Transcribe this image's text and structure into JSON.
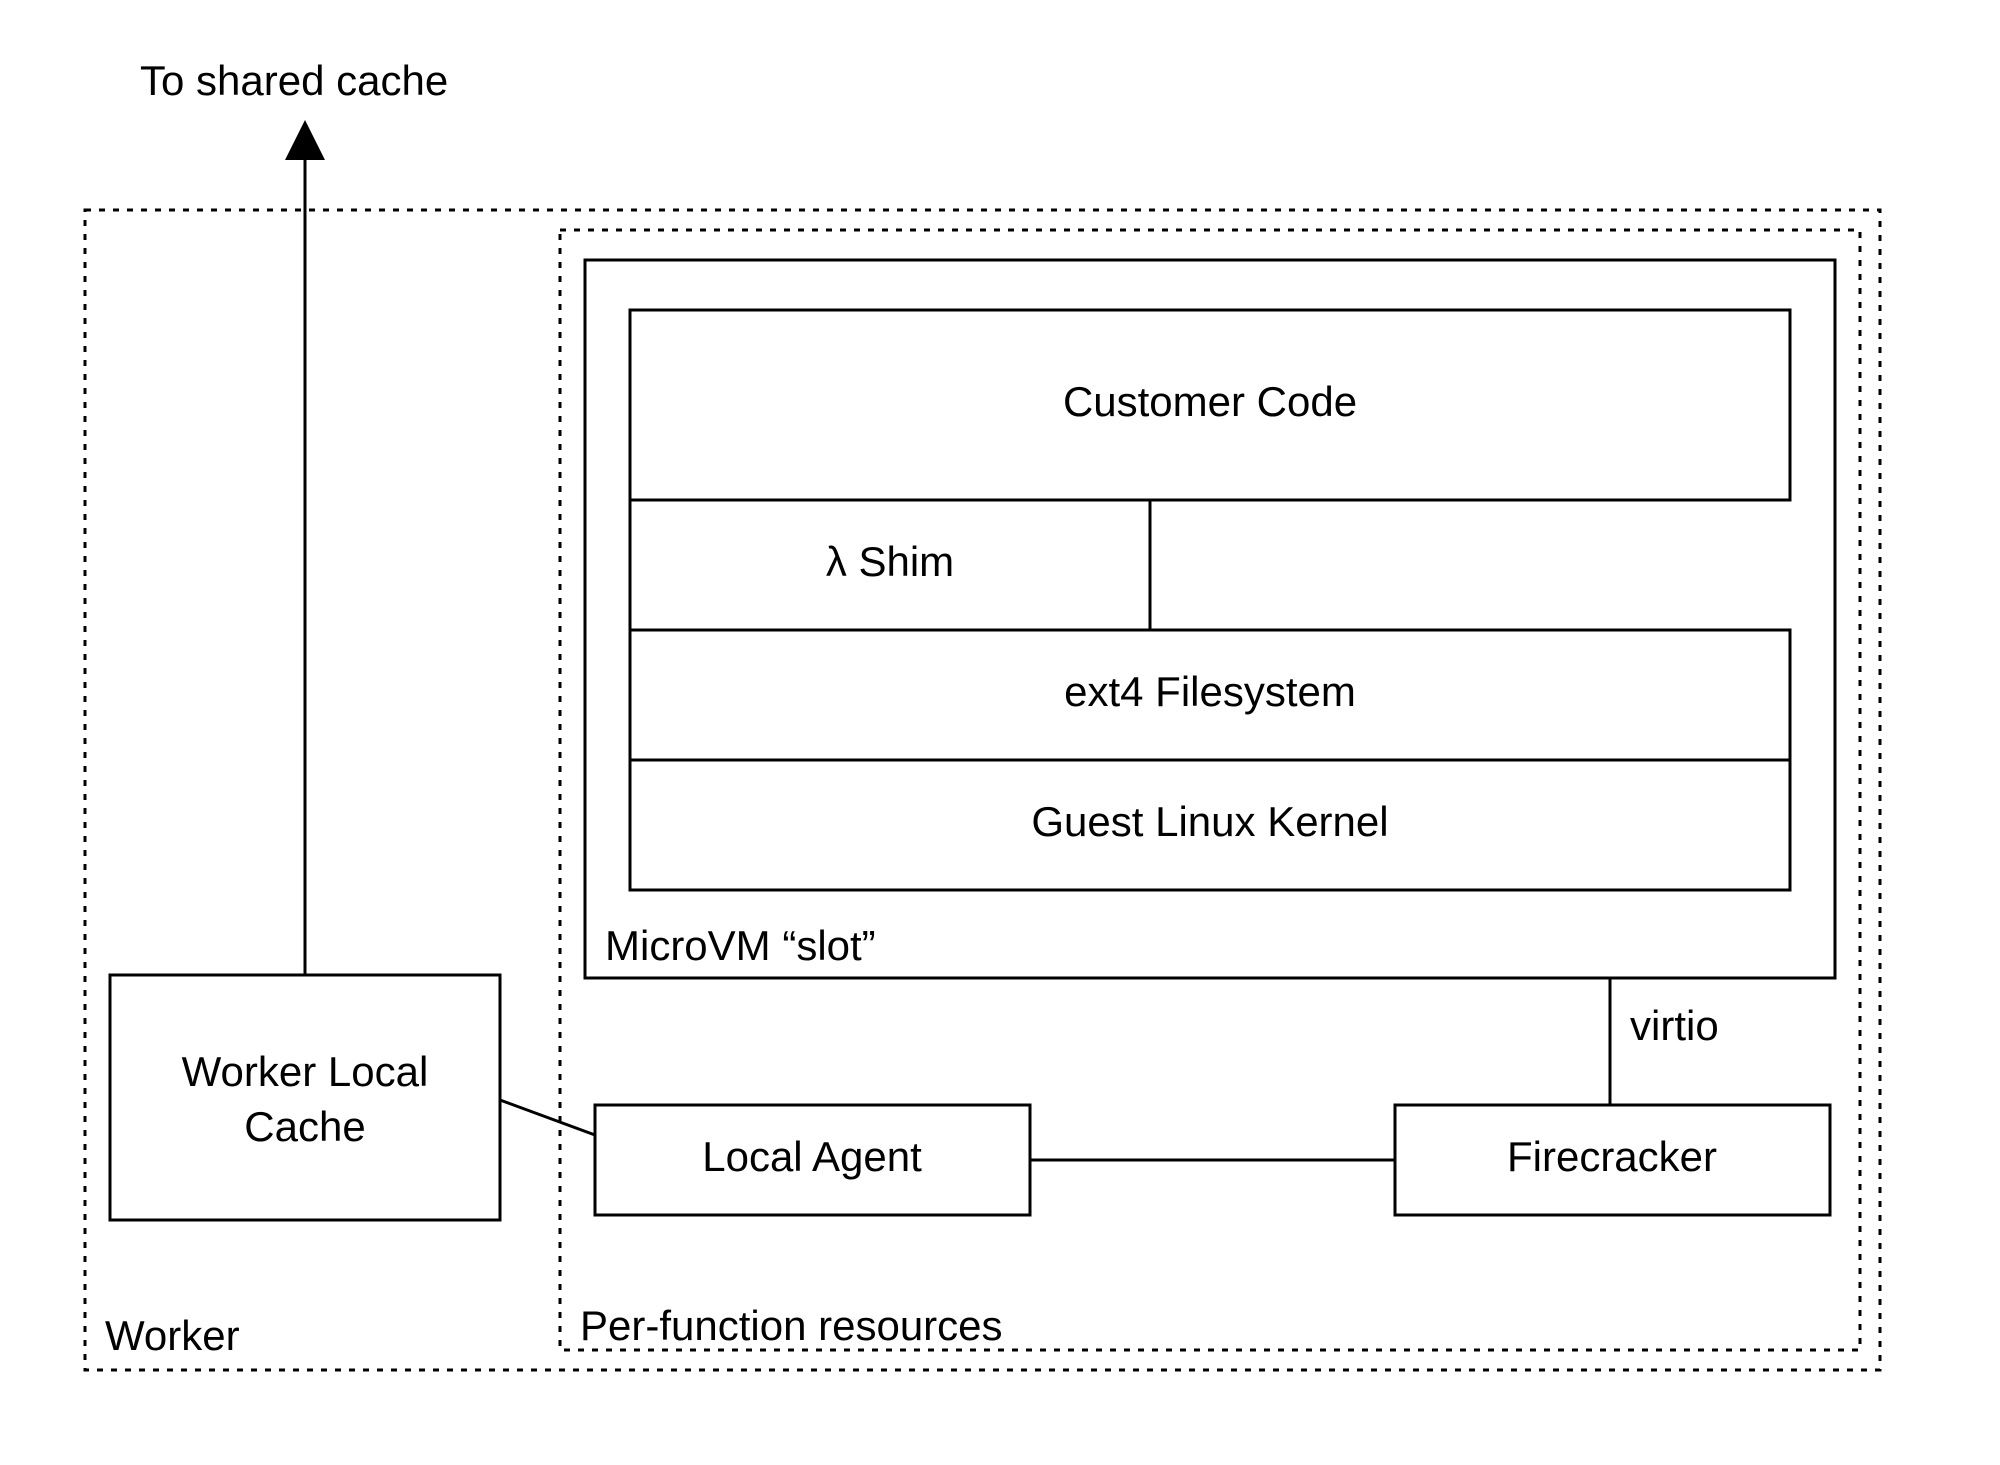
{
  "labels": {
    "to_shared_cache": "To shared cache",
    "worker_local_cache_l1": "Worker Local",
    "worker_local_cache_l2": "Cache",
    "customer_code": "Customer Code",
    "lambda_shim": "λ Shim",
    "ext4_filesystem": "ext4 Filesystem",
    "guest_linux_kernel": "Guest Linux Kernel",
    "microvm_slot": "MicroVM “slot”",
    "virtio": "virtio",
    "local_agent": "Local Agent",
    "firecracker": "Firecracker",
    "per_function_resources": "Per-function resources",
    "worker": "Worker"
  }
}
